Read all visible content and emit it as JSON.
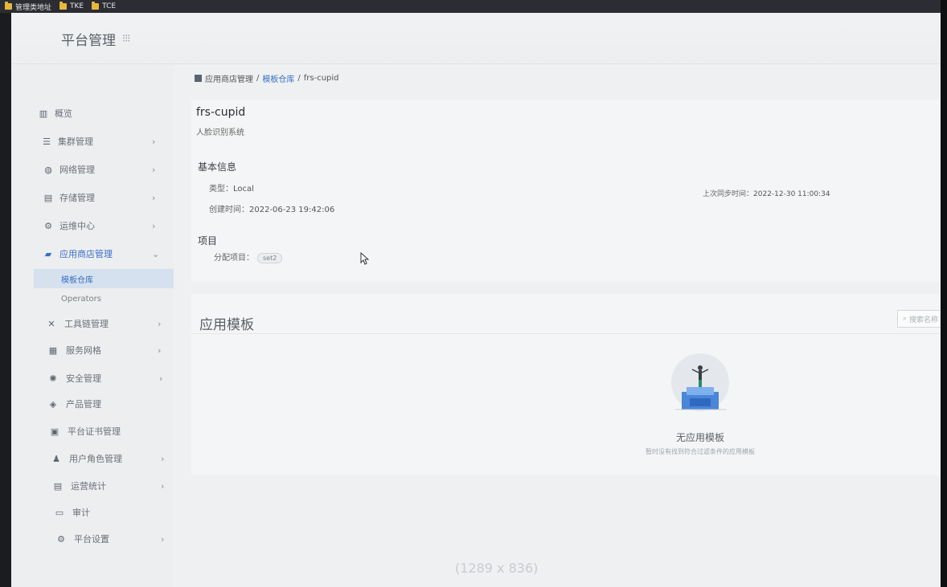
{
  "bookmarks": [
    {
      "label": "管理类地址"
    },
    {
      "label": "TKE"
    },
    {
      "label": "TCE"
    }
  ],
  "brand": {
    "title": "平台管理",
    "grid_icon": "grid-icon"
  },
  "sidebar": {
    "items": [
      {
        "label": "概览",
        "icon": "chart-icon",
        "has_chevron": false
      },
      {
        "label": "集群管理",
        "icon": "cluster-icon",
        "has_chevron": true
      },
      {
        "label": "网络管理",
        "icon": "globe-icon",
        "has_chevron": true
      },
      {
        "label": "存储管理",
        "icon": "database-icon",
        "has_chevron": true
      },
      {
        "label": "运维中心",
        "icon": "gear-icon",
        "has_chevron": true
      },
      {
        "label": "应用商店管理",
        "icon": "store-icon",
        "has_chevron": true,
        "expanded": true
      },
      {
        "label": "工具链管理",
        "icon": "tools-icon",
        "has_chevron": true
      },
      {
        "label": "服务网格",
        "icon": "mesh-icon",
        "has_chevron": true
      },
      {
        "label": "安全管理",
        "icon": "shield-icon",
        "has_chevron": true
      },
      {
        "label": "产品管理",
        "icon": "box-icon",
        "has_chevron": false
      },
      {
        "label": "平台证书管理",
        "icon": "certificate-icon",
        "has_chevron": false
      },
      {
        "label": "用户角色管理",
        "icon": "users-icon",
        "has_chevron": true
      },
      {
        "label": "运营统计",
        "icon": "stats-icon",
        "has_chevron": true
      },
      {
        "label": "审计",
        "icon": "audit-icon",
        "has_chevron": false
      },
      {
        "label": "平台设置",
        "icon": "settings-icon",
        "has_chevron": true
      }
    ],
    "subitems": [
      {
        "label": "模板仓库",
        "selected": true
      },
      {
        "label": "Operators",
        "selected": false
      }
    ]
  },
  "breadcrumb": {
    "root": "应用商店管理",
    "sep": "/",
    "link": "模板仓库",
    "current": "frs-cupid"
  },
  "app": {
    "name": "frs-cupid",
    "description": "人脸识别系统"
  },
  "basic_info": {
    "title": "基本信息",
    "type_label": "类型：",
    "type_value": "Local",
    "created_label": "创建时间：",
    "created_value": "2022-06-23 19:42:06",
    "sync_label": "上次同步时间：",
    "sync_value": "2022-12-30 11:00:34"
  },
  "project": {
    "title": "项目",
    "assigned_label": "分配项目：",
    "tag": "set2"
  },
  "templates": {
    "title": "应用模板",
    "search_placeholder": "搜索名称",
    "empty_title": "无应用模板",
    "empty_desc": "暂时没有找到符合过滤条件的应用模板"
  },
  "overlay": {
    "dimensions": "(1289 x 836)"
  },
  "colors": {
    "accent": "#3a6fc4",
    "folder": "#e8b73a",
    "selected_bg": "#d5e1ee"
  }
}
